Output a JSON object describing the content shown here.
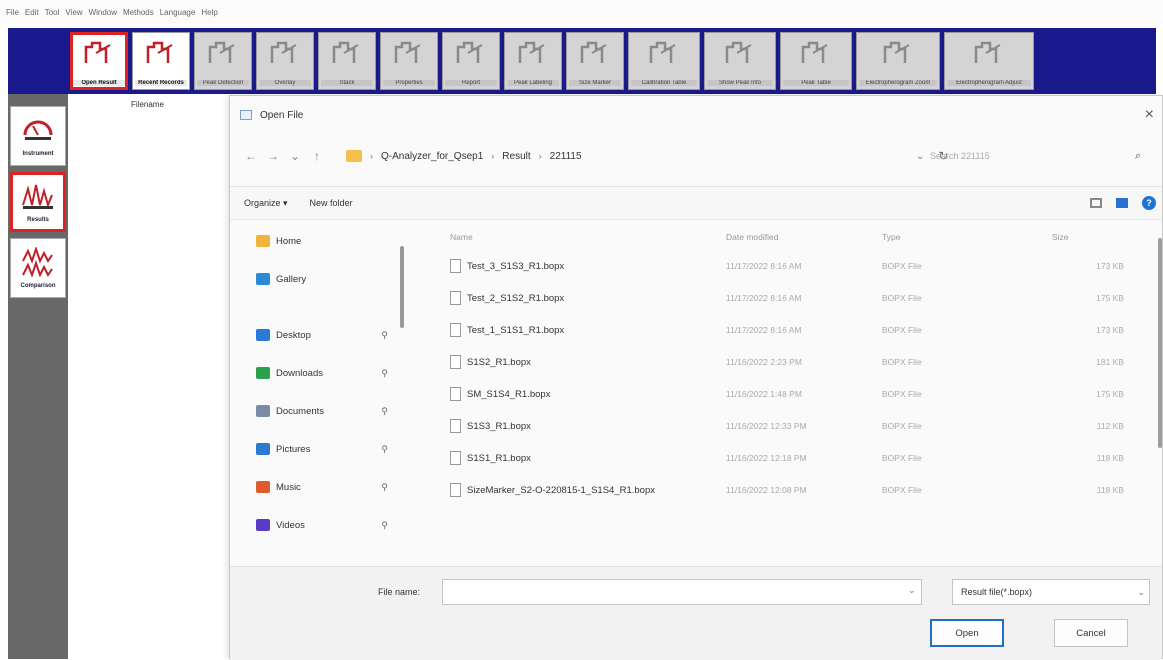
{
  "menubar": [
    "File",
    "Edit",
    "Tool",
    "View",
    "Window",
    "Methods",
    "Language",
    "Help"
  ],
  "toolbar": {
    "buttons": [
      {
        "label": "Open Result",
        "icon": "open-result-icon",
        "active": true,
        "highlight": true
      },
      {
        "label": "Recent Records",
        "icon": "recent-records-icon",
        "active": true,
        "highlight": false
      },
      {
        "label": "Peak Detection",
        "icon": "peak-icon",
        "active": false
      },
      {
        "label": "Overlay",
        "icon": "overlay-icon",
        "active": false
      },
      {
        "label": "Stack",
        "icon": "stack-icon",
        "active": false
      },
      {
        "label": "Properties",
        "icon": "properties-icon",
        "active": false
      },
      {
        "label": "Report",
        "icon": "report-icon",
        "active": false
      },
      {
        "label": "Peak Labeling",
        "icon": "peak-labeling-icon",
        "active": false
      },
      {
        "label": "Size Marker",
        "icon": "size-marker-icon",
        "active": false
      },
      {
        "label": "Calibration Table",
        "icon": "calibration-icon",
        "active": false
      },
      {
        "label": "Show Peak Info",
        "icon": "peak-info-icon",
        "active": false
      },
      {
        "label": "Peak Table",
        "icon": "peak-table-icon",
        "active": false
      },
      {
        "label": "Electropherogram Zoom",
        "icon": "zoom-icon",
        "active": false
      },
      {
        "label": "Electropherogram Adjust",
        "icon": "adjust-icon",
        "active": false
      }
    ]
  },
  "leftnav": [
    {
      "label": "Instrument",
      "icon": "instrument-gauge-icon",
      "highlight": false
    },
    {
      "label": "Results",
      "icon": "results-peaks-icon",
      "highlight": true
    },
    {
      "label": "Comparison",
      "icon": "comparison-peaks-icon",
      "highlight": false
    }
  ],
  "filename_column": "Filename",
  "dialog": {
    "title": "Open File",
    "close": "×",
    "nav": {
      "back": "←",
      "forward": "→",
      "recent": "⌄",
      "up": "↑"
    },
    "breadcrumb": [
      "Q-Analyzer_for_Qsep1",
      "Result",
      "221115"
    ],
    "search_placeholder": "Search 221115",
    "organize": "Organize ▾",
    "new_folder": "New folder",
    "sidebar": [
      {
        "label": "Home",
        "icon": "home-icon",
        "color": "#f0b43c",
        "pin": false
      },
      {
        "label": "Gallery",
        "icon": "gallery-icon",
        "color": "#2a8ad8",
        "pin": false
      },
      {
        "label": "Desktop",
        "icon": "desktop-icon",
        "color": "#2b7bd6",
        "pin": true
      },
      {
        "label": "Downloads",
        "icon": "downloads-icon",
        "color": "#2aa04a",
        "pin": true
      },
      {
        "label": "Documents",
        "icon": "documents-icon",
        "color": "#7a8ca8",
        "pin": true
      },
      {
        "label": "Pictures",
        "icon": "pictures-icon",
        "color": "#2a7ad0",
        "pin": true
      },
      {
        "label": "Music",
        "icon": "music-icon",
        "color": "#e05a2a",
        "pin": true
      },
      {
        "label": "Videos",
        "icon": "videos-icon",
        "color": "#5a3ac8",
        "pin": true
      }
    ],
    "pin_glyph": "📌",
    "columns": {
      "name": "Name",
      "date": "Date modified",
      "type": "Type",
      "size": "Size"
    },
    "files": [
      {
        "name": "Test_3_S1S3_R1.bopx",
        "date": "11/17/2022 8:16 AM",
        "type": "BOPX File",
        "size": "173 KB"
      },
      {
        "name": "Test_2_S1S2_R1.bopx",
        "date": "11/17/2022 8:16 AM",
        "type": "BOPX File",
        "size": "175 KB"
      },
      {
        "name": "Test_1_S1S1_R1.bopx",
        "date": "11/17/2022 8:16 AM",
        "type": "BOPX File",
        "size": "173 KB"
      },
      {
        "name": "S1S2_R1.bopx",
        "date": "11/16/2022 2:23 PM",
        "type": "BOPX File",
        "size": "181 KB"
      },
      {
        "name": "SM_S1S4_R1.bopx",
        "date": "11/16/2022 1:48 PM",
        "type": "BOPX File",
        "size": "175 KB"
      },
      {
        "name": "S1S3_R1.bopx",
        "date": "11/16/2022 12:33 PM",
        "type": "BOPX File",
        "size": "112 KB"
      },
      {
        "name": "S1S1_R1.bopx",
        "date": "11/16/2022 12:18 PM",
        "type": "BOPX File",
        "size": "118 KB"
      },
      {
        "name": "SizeMarker_S2-O-220815-1_S1S4_R1.bopx",
        "date": "11/16/2022 12:08 PM",
        "type": "BOPX File",
        "size": "118 KB"
      }
    ],
    "file_name_label": "File name:",
    "file_name_value": "",
    "filter": "Result file(*.bopx)",
    "open_button": "Open",
    "cancel_button": "Cancel"
  }
}
